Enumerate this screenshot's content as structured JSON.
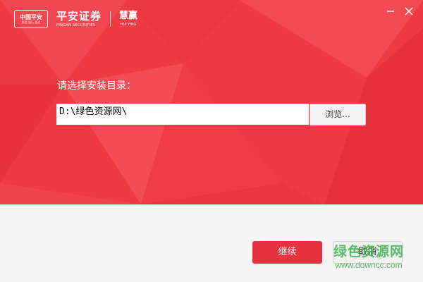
{
  "brand": {
    "logo_line1": "中国平安",
    "logo_line2": "保险 银行 投资",
    "name_cn": "平安证券",
    "name_en": "PINGAN SECURITIES",
    "product_cn": "慧赢",
    "product_en": "HUI YING"
  },
  "window_controls": {
    "minimize_icon": "minimize-icon",
    "close_icon": "close-icon"
  },
  "install": {
    "prompt": "请选择安装目录：",
    "path_value": "D:\\绿色资源网\\",
    "browse_label": "浏览..."
  },
  "footer": {
    "continue_label": "继续",
    "cancel_label": "取消"
  },
  "watermark": {
    "line1": "绿色资源网",
    "line2": "www.downcc.com"
  },
  "colors": {
    "primary_red": "#ef3a42",
    "button_red": "#e8323f",
    "footer_bg": "#f5f5f5",
    "watermark_green": "#3ab24e"
  }
}
